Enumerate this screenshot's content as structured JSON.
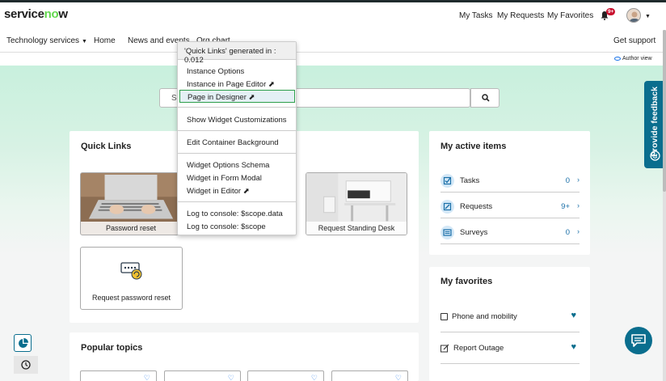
{
  "header": {
    "logo_text": "servicenow",
    "nav": [
      "My Tasks",
      "My Requests",
      "My Favorites"
    ],
    "notification_count": "9+"
  },
  "subnav": {
    "items": [
      "Technology services",
      "Home",
      "News and events",
      "Org chart"
    ],
    "get_support": "Get support",
    "author_view": "Author view"
  },
  "search": {
    "placeholder": "Se"
  },
  "quick_links": {
    "title": "Quick Links",
    "tiles": [
      "Password reset",
      "Request Standing Desk",
      "Request password reset"
    ]
  },
  "active_items": {
    "title": "My active items",
    "rows": [
      {
        "label": "Tasks",
        "count": "0"
      },
      {
        "label": "Requests",
        "count": "9+"
      },
      {
        "label": "Surveys",
        "count": "0"
      }
    ]
  },
  "favorites": {
    "title": "My favorites",
    "rows": [
      {
        "label": "Phone and mobility"
      },
      {
        "label": "Report Outage"
      }
    ]
  },
  "popular_topics": {
    "title": "Popular topics"
  },
  "context_menu": {
    "header": "'Quick Links' generated in : 0.012",
    "groups": [
      [
        "Instance Options",
        "Instance in Page Editor ⬈",
        "Page in Designer ⬈"
      ],
      [
        "Show Widget Customizations"
      ],
      [
        "Edit Container Background"
      ],
      [
        "Widget Options Schema",
        "Widget in Form Modal",
        "Widget in Editor ⬈"
      ],
      [
        "Log to console: $scope.data",
        "Log to console: $scope"
      ]
    ]
  },
  "feedback": {
    "label": "Provide feedback"
  },
  "colors": {
    "accent": "#0a6e8e",
    "badge": "#c8102e",
    "hero_top": "#c8f0dd"
  }
}
